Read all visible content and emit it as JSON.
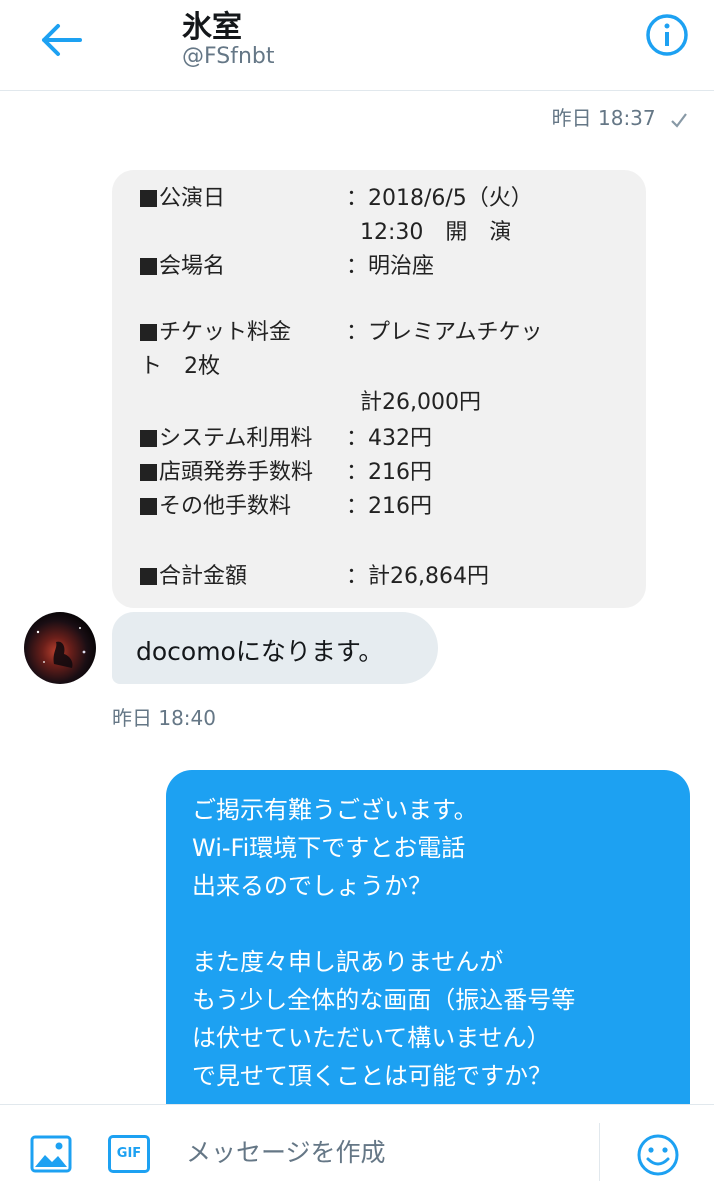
{
  "header": {
    "title": "氷室",
    "handle": "@FSfnbt"
  },
  "messages": {
    "sent_time_top": "昨日 18:37",
    "receipt": {
      "rows": [
        {
          "label": "公演日",
          "value": "：2018/6/5（火）"
        },
        {
          "label": "",
          "value": "  12:30　開　演"
        },
        {
          "label": "会場名",
          "value": "：明治座"
        },
        {
          "label": "チケット料金",
          "value": "：プレミアムチケッ"
        },
        {
          "label": "ト　2枚",
          "value": ""
        },
        {
          "label": "",
          "value": "  計26,000円"
        },
        {
          "label": "システム利用料",
          "value": "：432円"
        },
        {
          "label": "店頭発券手数料",
          "value": "：216円"
        },
        {
          "label": "その他手数料",
          "value": "：216円"
        },
        {
          "label": "合計金額",
          "value": "：計26,864円"
        }
      ]
    },
    "received_text": "docomoになります。",
    "received_time": "昨日 18:40",
    "sent_lines": [
      "ご掲示有難うございます。",
      "Wi-Fi環境下ですとお電話",
      "出来るのでしょうか？",
      "",
      "また度々申し訳ありませんが",
      "もう少し全体的な画面（振込番号等",
      "は伏せていただいて構いません）",
      "で見せて頂くことは可能ですか？"
    ]
  },
  "composer": {
    "gif_label": "GIF",
    "placeholder": "メッセージを作成"
  },
  "colors": {
    "accent": "#1da1f2",
    "received_bubble": "#e6ecf0",
    "receipt_bg": "#f1f1f1",
    "muted_text": "#657786"
  },
  "icons": {
    "back": "back-arrow-icon",
    "info": "info-icon",
    "check": "check-icon",
    "media": "image-icon",
    "gif": "gif-icon",
    "emoji": "emoji-icon"
  }
}
